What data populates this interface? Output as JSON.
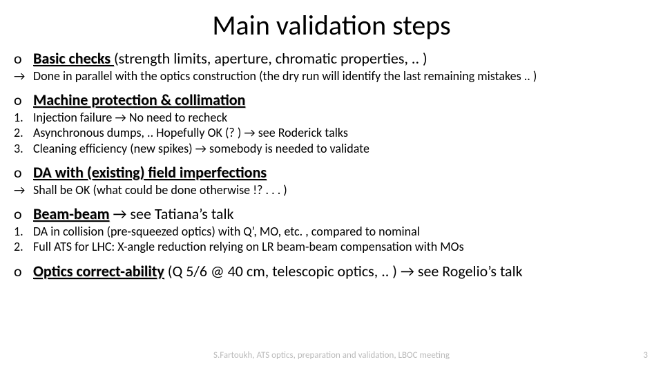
{
  "title": "Main validation steps",
  "arrow": "→",
  "s1": {
    "head_u": "Basic checks ",
    "head_rest": "(strength limits, aperture, chromatic properties, .. )",
    "sub": "Done in parallel with the optics construction (the dry run will identify the last remaining mistakes .. )"
  },
  "s2": {
    "head_u": "Machine protection & collimation",
    "items": [
      "Injection failure → No need to recheck",
      "Asynchronous dumps, .. Hopefully OK (? ) → see Roderick talks",
      "Cleaning efficiency (new spikes) → somebody is needed to validate"
    ]
  },
  "s3": {
    "head_u": "DA with (existing) field imperfections",
    "sub": "Shall be OK (what could be done otherwise !? . . . )"
  },
  "s4": {
    "head_u": "Beam-beam",
    "head_rest": " → see Tatiana’s talk",
    "items": [
      "DA  in collision (pre-squeezed optics) with Q’, MO, etc. , compared to nominal",
      "Full ATS for  LHC: X-angle reduction relying on LR beam-beam compensation with MOs"
    ]
  },
  "s5": {
    "head_u": "Optics correct-ability",
    "head_rest": " (Q 5/6 @ 40 cm, telescopic optics, .. ) → see Rogelio’s talk"
  },
  "footer_overlay": "S.Fartoukh, ATS optics, preparation and validation, LBOC meeting",
  "page_overlay": "3"
}
